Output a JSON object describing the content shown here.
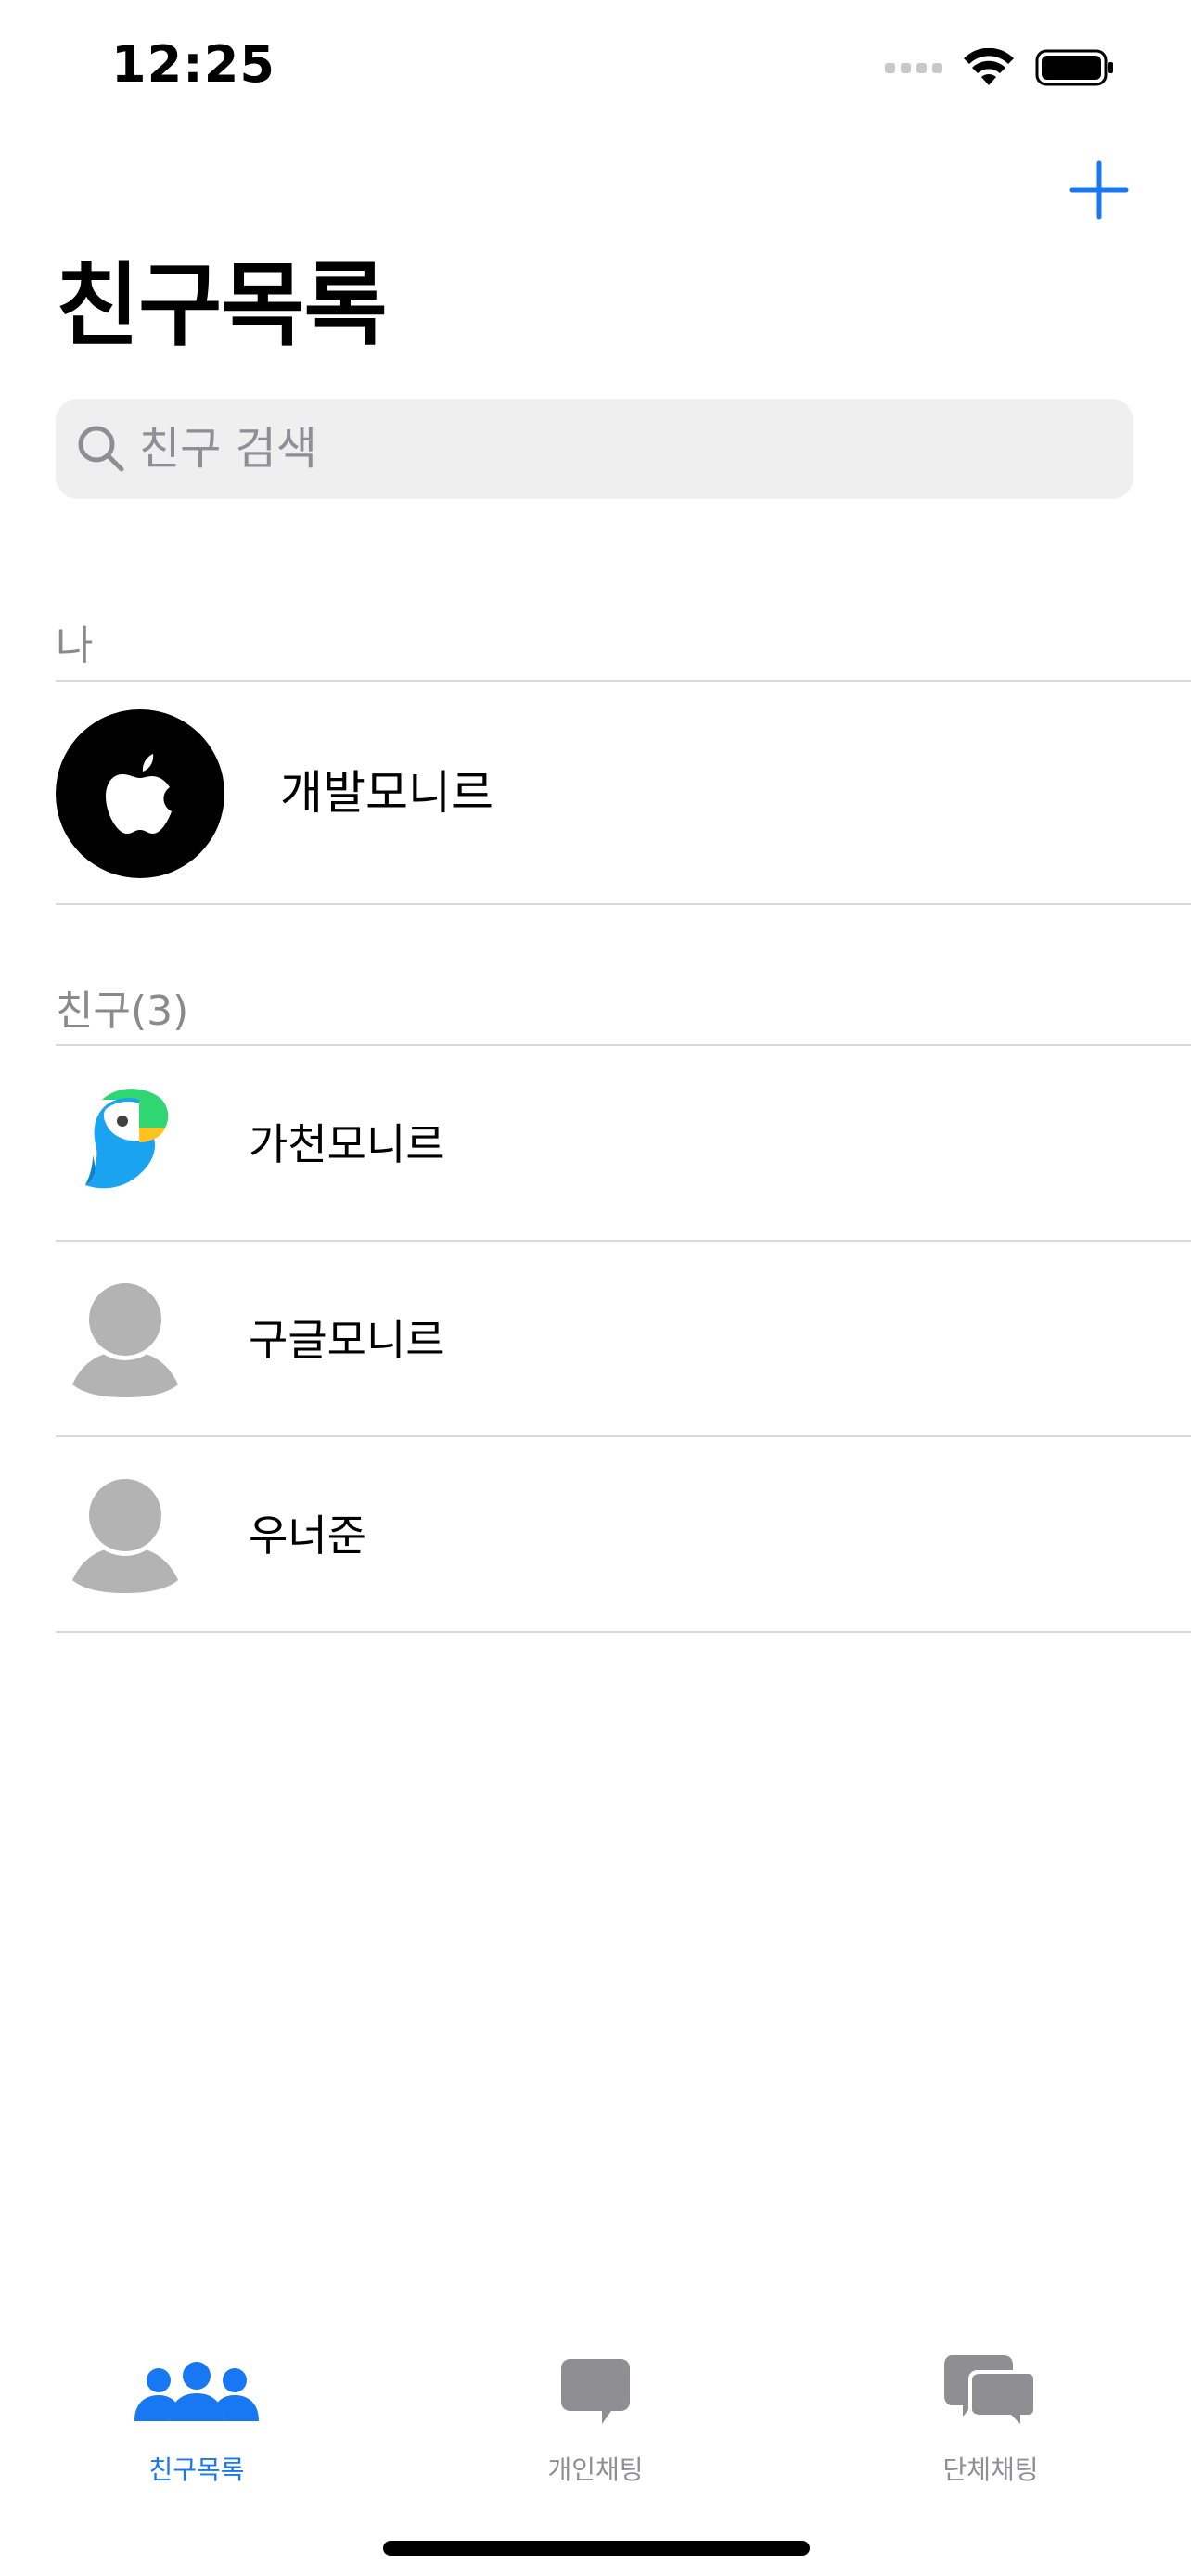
{
  "status_bar": {
    "time": "12:25",
    "wifi_icon": "wifi-icon",
    "battery_icon": "battery-icon",
    "signal_icon": "signal-icon"
  },
  "header": {
    "title": "친구목록",
    "add_icon": "plus-icon"
  },
  "search": {
    "placeholder": "친구 검색",
    "value": "",
    "icon": "search-icon"
  },
  "me_section": {
    "header": "나",
    "profile": {
      "name": "개발모니르",
      "avatar_icon": "apple-logo-icon"
    }
  },
  "friends_section": {
    "header": "친구(3)",
    "items": [
      {
        "name": "가천모니르",
        "avatar_icon": "parrot-avatar-icon"
      },
      {
        "name": "구글모니르",
        "avatar_icon": "default-person-icon"
      },
      {
        "name": "우너준",
        "avatar_icon": "default-person-icon"
      }
    ]
  },
  "tab_bar": {
    "tabs": [
      {
        "label": "친구목록",
        "icon": "people-icon",
        "active": true
      },
      {
        "label": "개인채팅",
        "icon": "chat-bubble-icon",
        "active": false
      },
      {
        "label": "단체채팅",
        "icon": "group-chat-icon",
        "active": false
      }
    ]
  },
  "colors": {
    "accent": "#1877f2",
    "inactive": "#8e8e93",
    "divider": "#d8d8d8",
    "search_bg": "#efefef",
    "avatar_gray": "#b3b3b3"
  }
}
